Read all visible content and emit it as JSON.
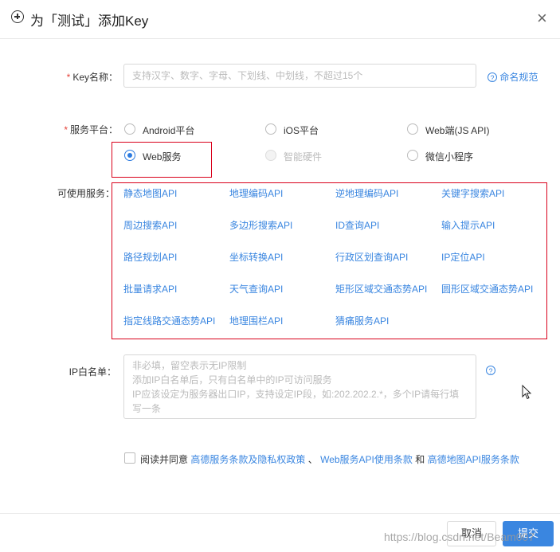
{
  "dialog": {
    "title": "为「测试」添加Key",
    "close_label": "×"
  },
  "form": {
    "key_name": {
      "required_mark": "*",
      "label": "Key名称：",
      "placeholder": "支持汉字、数字、字母、下划线、中划线，不超过15个",
      "help_link": "命名规范"
    },
    "platform": {
      "required_mark": "*",
      "label": "服务平台：",
      "options": [
        {
          "label": "Android平台",
          "checked": false,
          "disabled": false
        },
        {
          "label": "iOS平台",
          "checked": false,
          "disabled": false
        },
        {
          "label": "Web端(JS API)",
          "checked": false,
          "disabled": false
        },
        {
          "label": "Web服务",
          "checked": true,
          "disabled": false
        },
        {
          "label": "智能硬件",
          "checked": false,
          "disabled": true
        },
        {
          "label": "微信小程序",
          "checked": false,
          "disabled": false
        }
      ]
    },
    "services": {
      "label": "可使用服务：",
      "items": [
        "静态地图API",
        "地理编码API",
        "逆地理编码API",
        "关键字搜索API",
        "周边搜索API",
        "多边形搜索API",
        "ID查询API",
        "输入提示API",
        "路径规划API",
        "坐标转换API",
        "行政区划查询API",
        "IP定位API",
        "批量请求API",
        "天气查询API",
        "矩形区域交通态势API",
        "圆形区域交通态势API",
        "指定线路交通态势API",
        "地理围栏API",
        "猜痛服务API"
      ]
    },
    "ip_whitelist": {
      "label": "IP白名单：",
      "placeholder_lines": [
        "非必填，留空表示无IP限制",
        "添加IP白名单后，只有白名单中的IP可访问服务",
        "IP应该设定为服务器出口IP，支持设定IP段，如:202.202.2.*，多个IP请每行填",
        "写一条"
      ]
    },
    "agreement": {
      "prefix": "阅读并同意",
      "link1": "高德服务条款及隐私权政策",
      "sep1": "、",
      "link2": "Web服务API使用条款",
      "sep2": "和",
      "link3": "高德地图API服务条款"
    }
  },
  "footer": {
    "cancel_label": "取消",
    "submit_label": "提交"
  },
  "watermark": "https://blog.csdn.net/Beam007"
}
